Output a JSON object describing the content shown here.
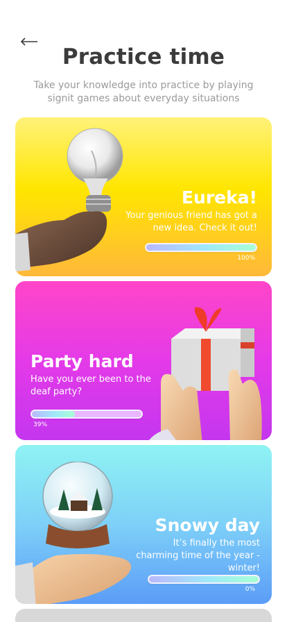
{
  "header": {
    "back_icon": "arrow-left-icon",
    "title": "Practice time",
    "subtitle": "Take your knowledge into practice by playing signit games about everyday situations"
  },
  "cards": [
    {
      "title": "Eureka!",
      "description": "Your genious friend has got a new idea. Check it out!",
      "progress_label": "100%",
      "progress": 1.0,
      "image_icon": "lightbulb-in-hand-icon",
      "colors": {
        "top": "#fff27a",
        "bottom": "#ffb83a"
      }
    },
    {
      "title": "Party hard",
      "description": "Have you ever been to the deaf party?",
      "progress_label": "39%",
      "progress": 0.39,
      "image_icon": "gift-box-in-hands-icon",
      "colors": {
        "top": "#ff45c8",
        "bottom": "#c436ef"
      }
    },
    {
      "title": "Snowy day",
      "description": "It’s finally the most charming time of the year - winter!",
      "progress_label": "0%",
      "progress": 1.0,
      "image_icon": "snow-globe-in-hand-icon",
      "colors": {
        "top": "#8ff3f3",
        "bottom": "#5b9cf7"
      }
    }
  ]
}
